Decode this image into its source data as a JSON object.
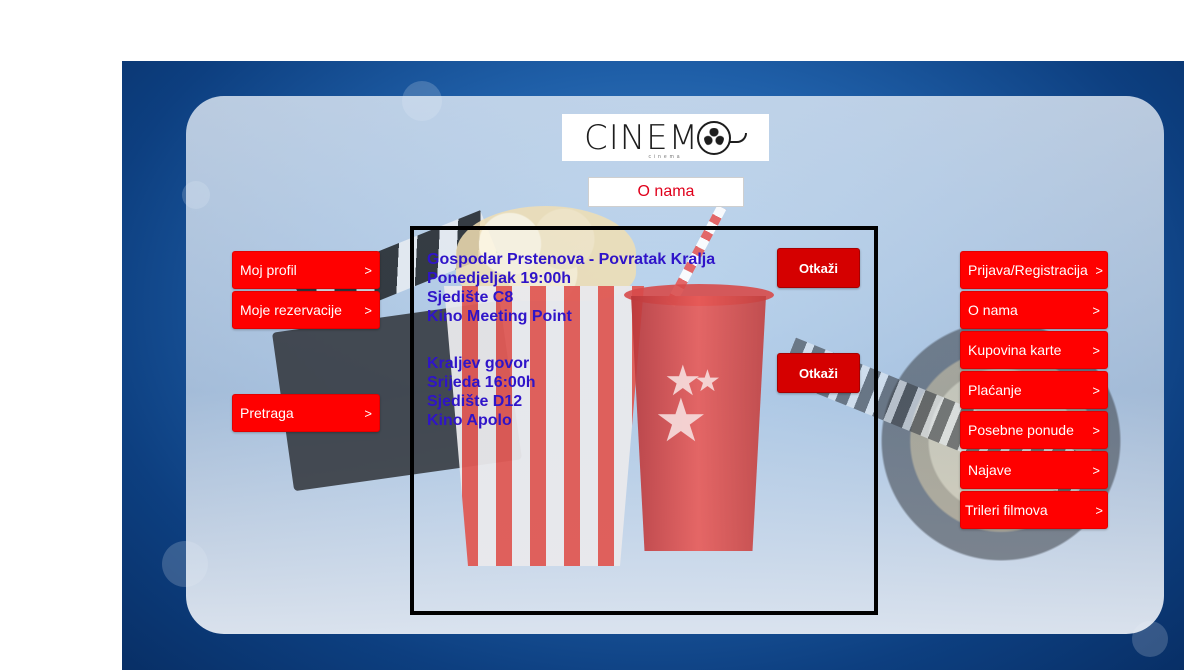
{
  "logo": {
    "text": "CINEM",
    "sub": "cinema"
  },
  "about_button": "O nama",
  "left_menu": [
    {
      "label": "Moj profil",
      "arrow": ">"
    },
    {
      "label": "Moje rezervacije",
      "arrow": ">"
    },
    {
      "label": "Pretraga",
      "arrow": ">"
    }
  ],
  "right_menu": [
    {
      "label": "Prijava/Registracija",
      "arrow": ">"
    },
    {
      "label": "O nama",
      "arrow": ">"
    },
    {
      "label": "Kupovina karte",
      "arrow": ">"
    },
    {
      "label": "Plaćanje",
      "arrow": ">"
    },
    {
      "label": "Posebne ponude",
      "arrow": ">"
    },
    {
      "label": "Najave",
      "arrow": ">"
    },
    {
      "label": "Trileri filmova",
      "arrow": ">"
    }
  ],
  "reservations": [
    {
      "movie": "Gospodar Prstenova - Povratak Kralja",
      "time": "Ponedjeljak 19:00h",
      "seat": "Sjedište C8",
      "cinema": "Kino Meeting Point",
      "cancel_label": "Otkaži"
    },
    {
      "movie": "Kraljev govor",
      "time": "Srijeda 16:00h",
      "seat": "Sjedište D12",
      "cinema": "Kino Apolo",
      "cancel_label": "Otkaži"
    }
  ],
  "colors": {
    "menu_button": "#ff0000",
    "cancel_button": "#d50000",
    "reservation_text": "#2f14c9",
    "about_text": "#e0001b"
  }
}
